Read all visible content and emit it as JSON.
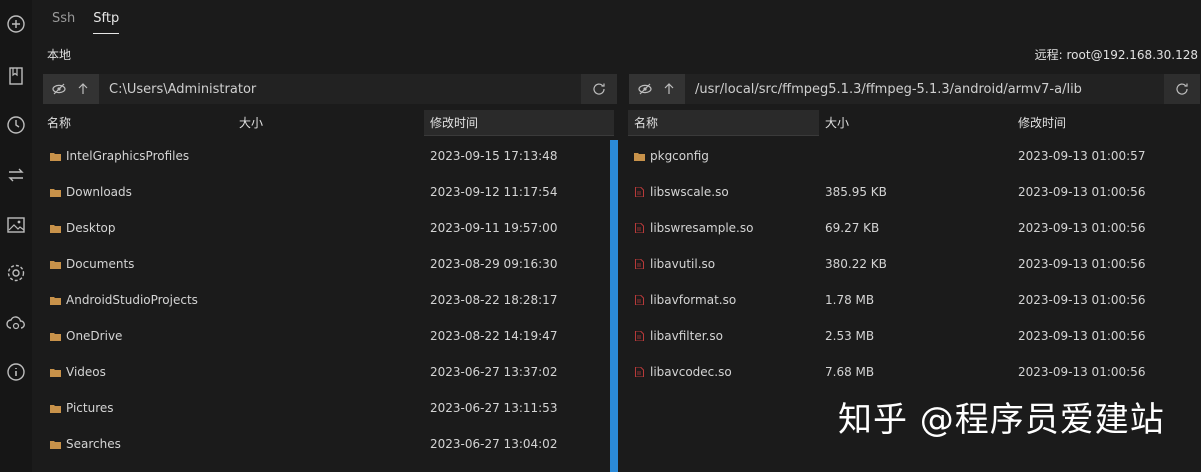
{
  "tabs": [
    {
      "label": "Ssh",
      "active": false
    },
    {
      "label": "Sftp",
      "active": true
    }
  ],
  "sidebar": {
    "icons": [
      "add-icon",
      "bookmark-icon",
      "history-icon",
      "transfer-icon",
      "image-icon",
      "gear-icon",
      "cloud-sync-icon",
      "info-icon"
    ]
  },
  "local": {
    "label": "本地",
    "path": "C:\\Users\\Administrator",
    "columns": {
      "name": "名称",
      "size": "大小",
      "modified": "修改时间"
    },
    "rows": [
      {
        "name": "IntelGraphicsProfiles",
        "size": "",
        "modified": "2023-09-15 17:13:48",
        "type": "folder"
      },
      {
        "name": "Downloads",
        "size": "",
        "modified": "2023-09-12 11:17:54",
        "type": "folder"
      },
      {
        "name": "Desktop",
        "size": "",
        "modified": "2023-09-11 19:57:00",
        "type": "folder"
      },
      {
        "name": "Documents",
        "size": "",
        "modified": "2023-08-29 09:16:30",
        "type": "folder"
      },
      {
        "name": "AndroidStudioProjects",
        "size": "",
        "modified": "2023-08-22 18:28:17",
        "type": "folder"
      },
      {
        "name": "OneDrive",
        "size": "",
        "modified": "2023-08-22 14:19:47",
        "type": "folder"
      },
      {
        "name": "Videos",
        "size": "",
        "modified": "2023-06-27 13:37:02",
        "type": "folder"
      },
      {
        "name": "Pictures",
        "size": "",
        "modified": "2023-06-27 13:11:53",
        "type": "folder"
      },
      {
        "name": "Searches",
        "size": "",
        "modified": "2023-06-27 13:04:02",
        "type": "folder"
      }
    ]
  },
  "remote": {
    "label": "远程: root@192.168.30.128",
    "path": "/usr/local/src/ffmpeg5.1.3/ffmpeg-5.1.3/android/armv7-a/lib",
    "columns": {
      "name": "名称",
      "size": "大小",
      "modified": "修改时间"
    },
    "rows": [
      {
        "name": "pkgconfig",
        "size": "",
        "modified": "2023-09-13 01:00:57",
        "type": "folder"
      },
      {
        "name": "libswscale.so",
        "size": "385.95 KB",
        "modified": "2023-09-13 01:00:56",
        "type": "file"
      },
      {
        "name": "libswresample.so",
        "size": "69.27 KB",
        "modified": "2023-09-13 01:00:56",
        "type": "file"
      },
      {
        "name": "libavutil.so",
        "size": "380.22 KB",
        "modified": "2023-09-13 01:00:56",
        "type": "file"
      },
      {
        "name": "libavformat.so",
        "size": "1.78 MB",
        "modified": "2023-09-13 01:00:56",
        "type": "file"
      },
      {
        "name": "libavfilter.so",
        "size": "2.53 MB",
        "modified": "2023-09-13 01:00:56",
        "type": "file"
      },
      {
        "name": "libavcodec.so",
        "size": "7.68 MB",
        "modified": "2023-09-13 01:00:56",
        "type": "file"
      }
    ]
  },
  "watermark": "知乎 @程序员爱建站",
  "colors": {
    "accent": "#2b8ad8",
    "folder": "#c8924a",
    "file": "#b83a3a"
  }
}
